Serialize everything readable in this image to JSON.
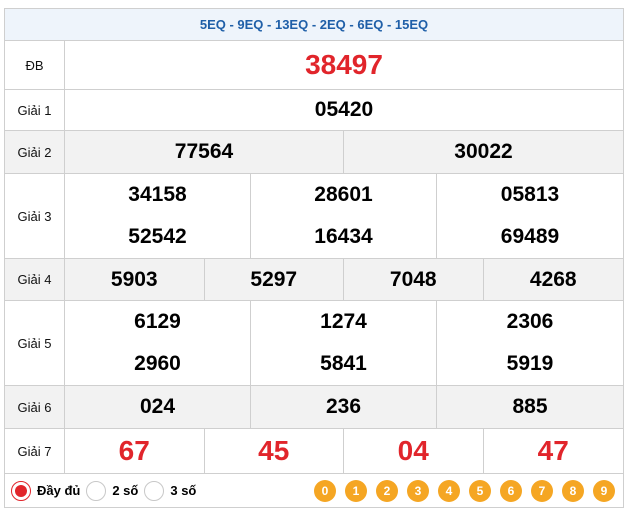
{
  "header": {
    "codes": "5EQ - 9EQ - 13EQ - 2EQ - 6EQ - 15EQ"
  },
  "rows": {
    "db": {
      "label": "ĐB",
      "values": [
        "38497"
      ]
    },
    "g1": {
      "label": "Giải 1",
      "values": [
        "05420"
      ]
    },
    "g2": {
      "label": "Giải 2",
      "values": [
        "77564",
        "30022"
      ]
    },
    "g3": {
      "label": "Giải 3",
      "values": [
        "34158",
        "28601",
        "05813",
        "52542",
        "16434",
        "69489"
      ]
    },
    "g4": {
      "label": "Giải 4",
      "values": [
        "5903",
        "5297",
        "7048",
        "4268"
      ]
    },
    "g5": {
      "label": "Giải 5",
      "values": [
        "6129",
        "1274",
        "2306",
        "2960",
        "5841",
        "5919"
      ]
    },
    "g6": {
      "label": "Giải 6",
      "values": [
        "024",
        "236",
        "885"
      ]
    },
    "g7": {
      "label": "Giải 7",
      "values": [
        "67",
        "45",
        "04",
        "47"
      ]
    }
  },
  "footer": {
    "options": [
      {
        "label": "Đầy đủ",
        "selected": true
      },
      {
        "label": "2 số",
        "selected": false
      },
      {
        "label": "3 số",
        "selected": false
      }
    ],
    "digits": [
      "0",
      "1",
      "2",
      "3",
      "4",
      "5",
      "6",
      "7",
      "8",
      "9"
    ]
  },
  "colors": {
    "accent_red": "#e1252b",
    "header_blue": "#1f5fa8",
    "digit_orange": "#f5a623"
  }
}
